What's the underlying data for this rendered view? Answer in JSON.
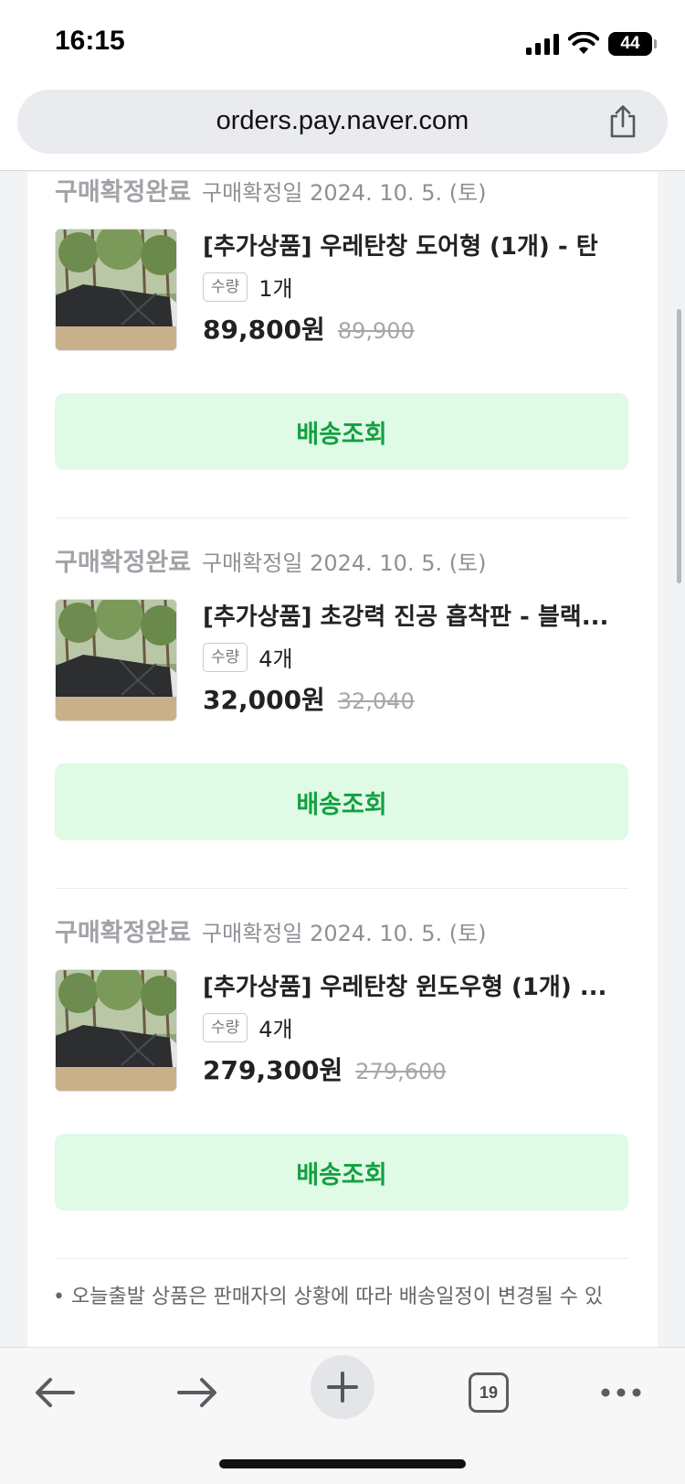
{
  "status_bar": {
    "time": "16:15",
    "battery": "44"
  },
  "browser": {
    "url": "orders.pay.naver.com",
    "tab_count": "19"
  },
  "orders": [
    {
      "status": "구매확정완료",
      "confirm_date": "구매확정일 2024. 10. 5. (토)",
      "product_name": "[추가상품] 우레탄창 도어형 (1개) - 탄",
      "qty_label": "수량",
      "qty": "1개",
      "price": "89,800원",
      "original_price": "89,900",
      "button_label": "배송조회"
    },
    {
      "status": "구매확정완료",
      "confirm_date": "구매확정일 2024. 10. 5. (토)",
      "product_name": "[추가상품] 초강력 진공 흡착판 - 블랙...",
      "qty_label": "수량",
      "qty": "4개",
      "price": "32,000원",
      "original_price": "32,040",
      "button_label": "배송조회"
    },
    {
      "status": "구매확정완료",
      "confirm_date": "구매확정일 2024. 10. 5. (토)",
      "product_name": "[추가상품] 우레탄창 윈도우형 (1개) ...",
      "qty_label": "수량",
      "qty": "4개",
      "price": "279,300원",
      "original_price": "279,600",
      "button_label": "배송조회"
    }
  ],
  "notice": "• 오늘출발 상품은 판매자의 상황에 따라 배송일정이 변경될 수 있",
  "icons": {
    "share": "share-icon",
    "back": "arrow-left-icon",
    "forward": "arrow-right-icon",
    "new_tab": "plus-icon",
    "tabs": "tabs-icon",
    "more": "more-icon"
  },
  "colors": {
    "track_button_bg": "#dffae5",
    "track_button_text": "#13a041",
    "status_label": "#a1a3a8"
  }
}
